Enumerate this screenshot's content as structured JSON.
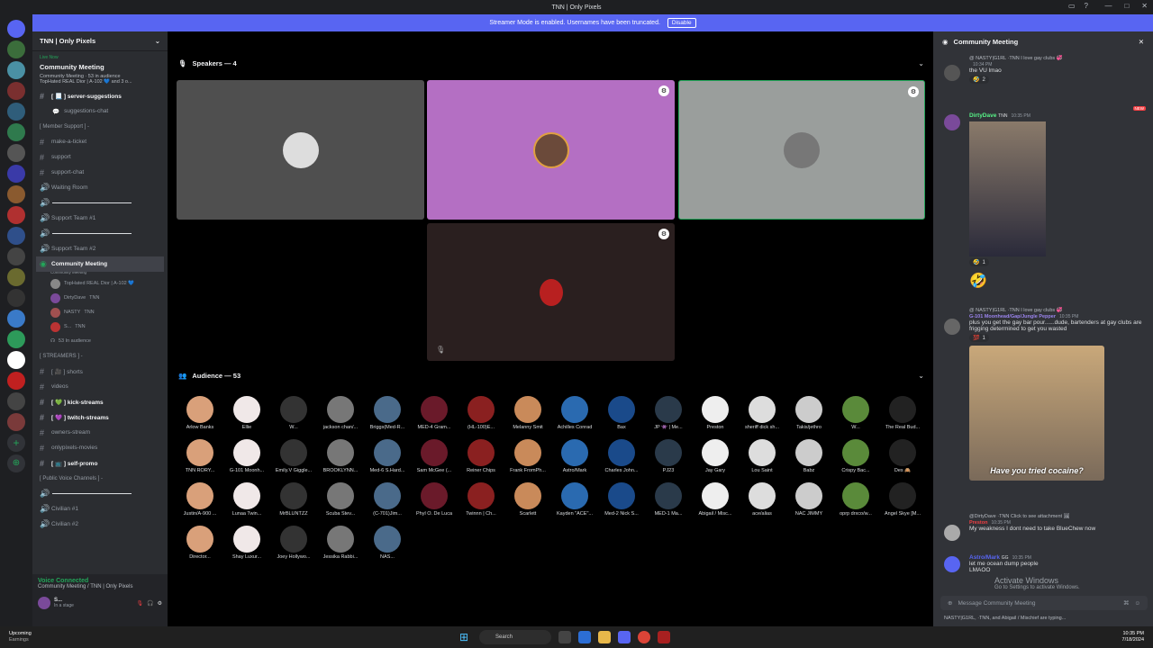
{
  "window": {
    "title": "TNN | Only Pixels"
  },
  "banner": {
    "text": "Streamer Mode is enabled. Usernames have been truncated.",
    "button": "Disable"
  },
  "server": {
    "name": "TNN | Only Pixels"
  },
  "event": {
    "live": "Live Now",
    "title": "Community Meeting",
    "meta": "Community Meeting · 53 in audience",
    "speakers": "TopHated REAL Dior | A-102 💙 and 3 o..."
  },
  "channels": [
    {
      "label": "[ 📃 ] server-suggestions",
      "bold": true
    },
    {
      "label": "suggestions-chat",
      "bold": false
    }
  ],
  "cat_support": "[ Member Support ] -",
  "support_channels": [
    "make-a-ticket",
    "support",
    "support-chat",
    "Waiting Room"
  ],
  "support_team1": "Support Team #1",
  "support_team2": "Support Team #2",
  "stage": {
    "name": "Community Meeting",
    "sub": "Community Meeting",
    "members": [
      {
        "name": "TopHated REAL Dior | A-102 💙"
      },
      {
        "name": "DirtyDave",
        "tag": "TNN"
      },
      {
        "name": "NASTY",
        "tag": "TNN"
      },
      {
        "name": "S...",
        "tag": "TNN"
      }
    ],
    "audience": "53 In audience"
  },
  "cat_streamers": "[ STREAMERS ] -",
  "streamer_channels": [
    {
      "label": "[ 🎥 ] shorts",
      "bold": false
    },
    {
      "label": "videos",
      "bold": false
    },
    {
      "label": "[ 💚 ] kick-streams",
      "bold": true
    },
    {
      "label": "[ 💜 ] twitch-streams",
      "bold": true
    },
    {
      "label": "owners-stream",
      "bold": false
    },
    {
      "label": "onlypixels-movies",
      "bold": false
    },
    {
      "label": "[ 📺 ] self-promo",
      "bold": true
    }
  ],
  "cat_public": "[ Public Voice Channels ] -",
  "civilian": [
    "Civilian #1",
    "Civilian #2"
  ],
  "voice": {
    "status": "Voice Connected",
    "channel": "Community Meeting / TNN | Only Pixels",
    "user": "S...",
    "state": "In a stage"
  },
  "speakers_title": "Speakers — 4",
  "audience_title": "Audience — 53",
  "audience": [
    "Arlow Banks",
    "Ellie",
    "W...",
    "jackson chan/...",
    "Briggs(Med-R...",
    "MED-4 Gram...",
    "(HL-100)E...",
    "Melanny Smit",
    "Achilles Conrad",
    "Bax",
    "JP 👾 | Me...",
    "Preston",
    "sheriff dick sh...",
    "Takis/jethro",
    "W...",
    "The Real Bud...",
    "TNN RORY...",
    "G-101 Moonh...",
    "Emily.V Giggle...",
    "BROOKLYNN...",
    "Med-6 S.Hard...",
    "Sam McGee (...",
    "Reiner Chips",
    "Frank FromPh...",
    "Astro/Mark",
    "Charles John...",
    "PJ23",
    "Jay Gary",
    "Lou Saint",
    "Babz",
    "Crispy Bac...",
    "Des 🙈",
    "Justin/A-900 ...",
    "Lunaa Twin...",
    "MrBLUNTZZ",
    "Scuba Stev...",
    "(C-701)Jim...",
    "Phyl O. De Luca",
    "Twinnn | Ch...",
    "Scarlett",
    "Kayden \"ACE\"...",
    "Med-2 Nick S...",
    "MED-1 Ma...",
    "Abigail / Misc...",
    "ace/alias",
    "NAC JIMMY",
    "oprp drxco/w...",
    "Angel Skye [M...",
    "Director...",
    "Shay Luxur...",
    "Joey Hollywo...",
    "Jessika Rabbi...",
    "NAS..."
  ],
  "chat": {
    "title": "Community Meeting",
    "messages": [
      {
        "reply": "@ NASTY|G1RL ·TNN I love gay clubs 💞",
        "user": "",
        "time": "10:34 PM",
        "text": "the VU lmao",
        "react": "2"
      },
      {
        "user": "DirtyDave",
        "tag": "TNN",
        "time": "10:35 PM",
        "text": "",
        "react": "1"
      },
      {
        "reply": "@ NASTY|G1RL ·TNN I love gay clubs 💞",
        "user": "G-101 Moonhead/Gap/Jungle Pepper",
        "time": "10:35 PM",
        "text": "plus you get the gay bar pour......dude, bartenders at gay clubs are frigging determined to get you wasted",
        "react": "1"
      },
      {
        "reply": "@DirtyDave ·TNN Click to see attachment 🖼",
        "user": "Preston",
        "time": "10:35 PM",
        "text": "My weakness I dont need to take BlueChew now"
      },
      {
        "user": "Astro/Mark",
        "tag": "GG",
        "time": "10:35 PM",
        "text": "let me ocean dump people",
        "text2": "LMAOO"
      }
    ],
    "caption": "Have you tried cocaine?",
    "new": "NEW",
    "input_placeholder": "Message Community Meeting",
    "typing": "NASTY|G1RL, ·TNN, and Abigail / Mischief are typing..."
  },
  "activate": {
    "title": "Activate Windows",
    "sub": "Go to Settings to activate Windows."
  },
  "taskbar": {
    "weather": "Upcoming",
    "weather2": "Earnings",
    "search": "Search",
    "time": "10:35 PM",
    "date": "7/18/2024"
  }
}
